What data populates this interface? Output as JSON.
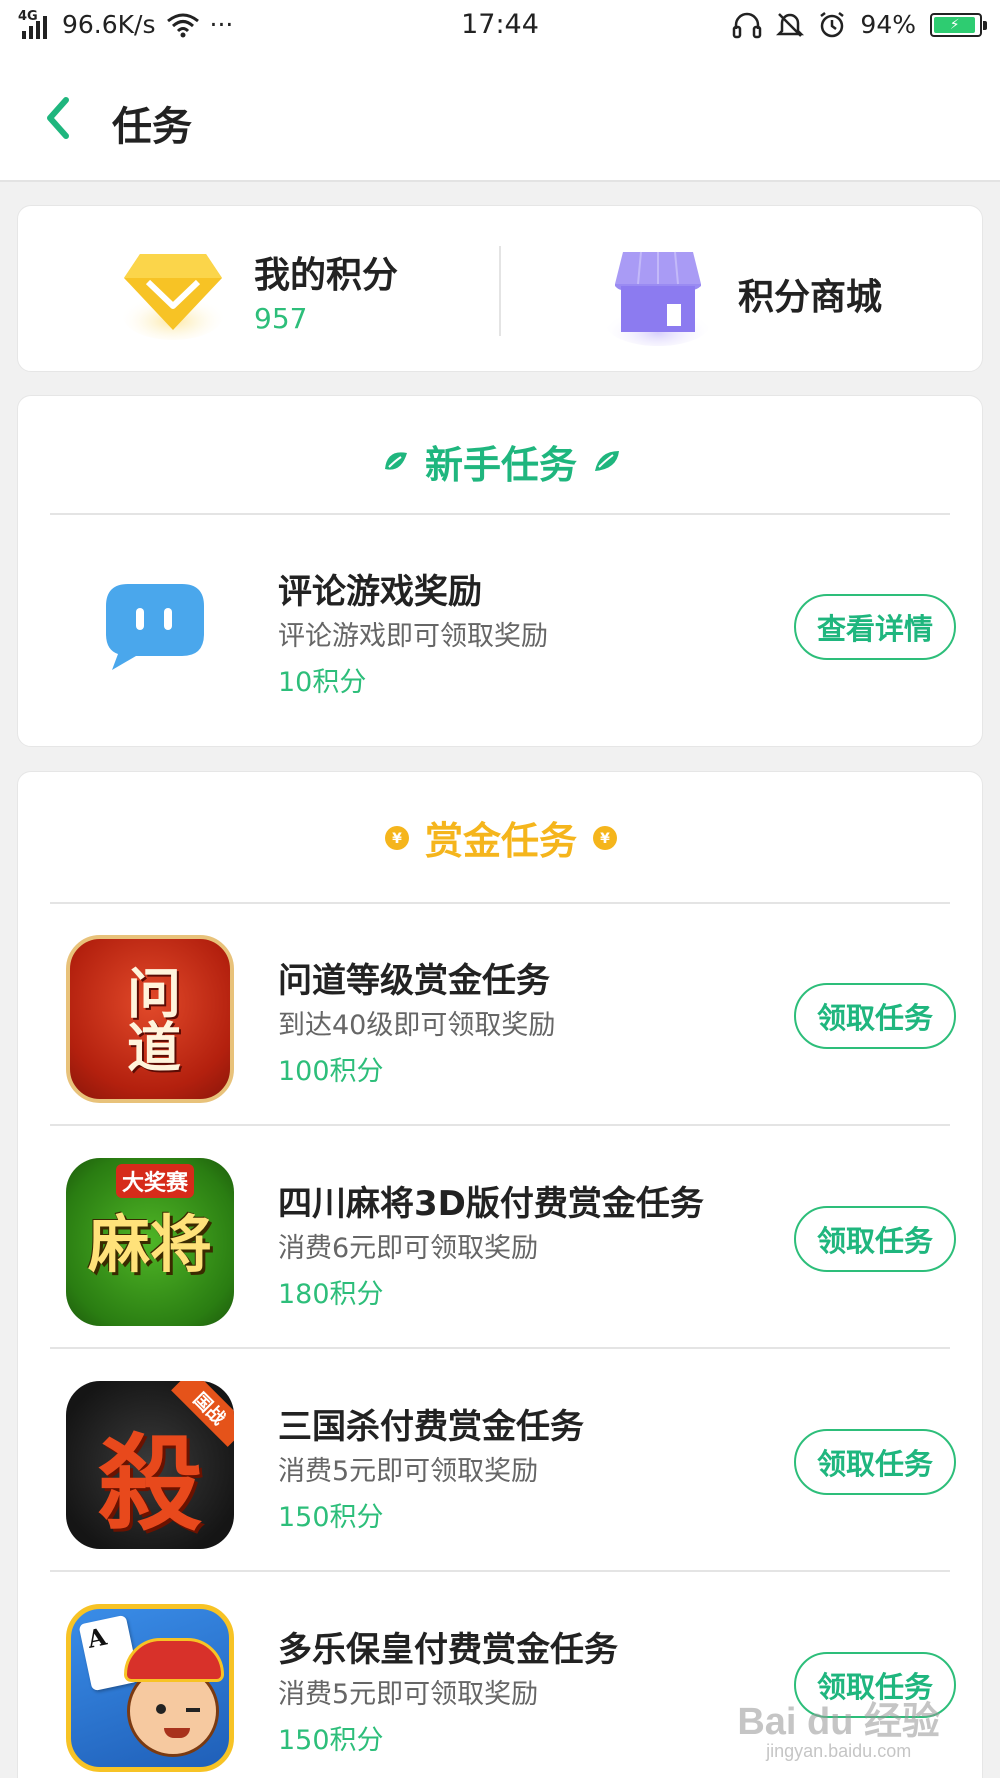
{
  "status_bar": {
    "network": "4G",
    "speed": "96.6K/s",
    "more": "···",
    "time": "17:44",
    "battery": "94%"
  },
  "header": {
    "title": "任务"
  },
  "points": {
    "label": "我的积分",
    "value": "957",
    "shop_label": "积分商城"
  },
  "newbie_section": {
    "title": "新手任务",
    "tasks": [
      {
        "title": "评论游戏奖励",
        "desc": "评论游戏即可领取奖励",
        "points": "10积分",
        "button": "查看详情",
        "icon": "comment-bubble-icon"
      }
    ]
  },
  "bounty_section": {
    "title": "赏金任务",
    "tasks": [
      {
        "title": "问道等级赏金任务",
        "desc": "到达40级即可领取奖励",
        "points": "100积分",
        "button": "领取任务",
        "icon": "wendao-game-icon",
        "icon_text": "问道"
      },
      {
        "title": "四川麻将3D版付费赏金任务",
        "desc": "消费6元即可领取奖励",
        "points": "180积分",
        "button": "领取任务",
        "icon": "mahjong-game-icon",
        "icon_badge": "大奖赛",
        "icon_text": "麻将"
      },
      {
        "title": "三国杀付费赏金任务",
        "desc": "消费5元即可领取奖励",
        "points": "150积分",
        "button": "领取任务",
        "icon": "sanguosha-game-icon",
        "icon_badge": "国战",
        "icon_text": "殺"
      },
      {
        "title": "多乐保皇付费赏金任务",
        "desc": "消费5元即可领取奖励",
        "points": "150积分",
        "button": "领取任务",
        "icon": "duole-baohuang-game-icon",
        "icon_text": "A"
      }
    ]
  },
  "watermark": {
    "brand": "Bai du 经验",
    "url": "jingyan.baidu.com"
  },
  "colors": {
    "accent_green": "#2dbe7a",
    "bounty_yellow": "#f5b51c",
    "gem_yellow": "#f7c325",
    "shop_purple": "#8c7bf0"
  }
}
